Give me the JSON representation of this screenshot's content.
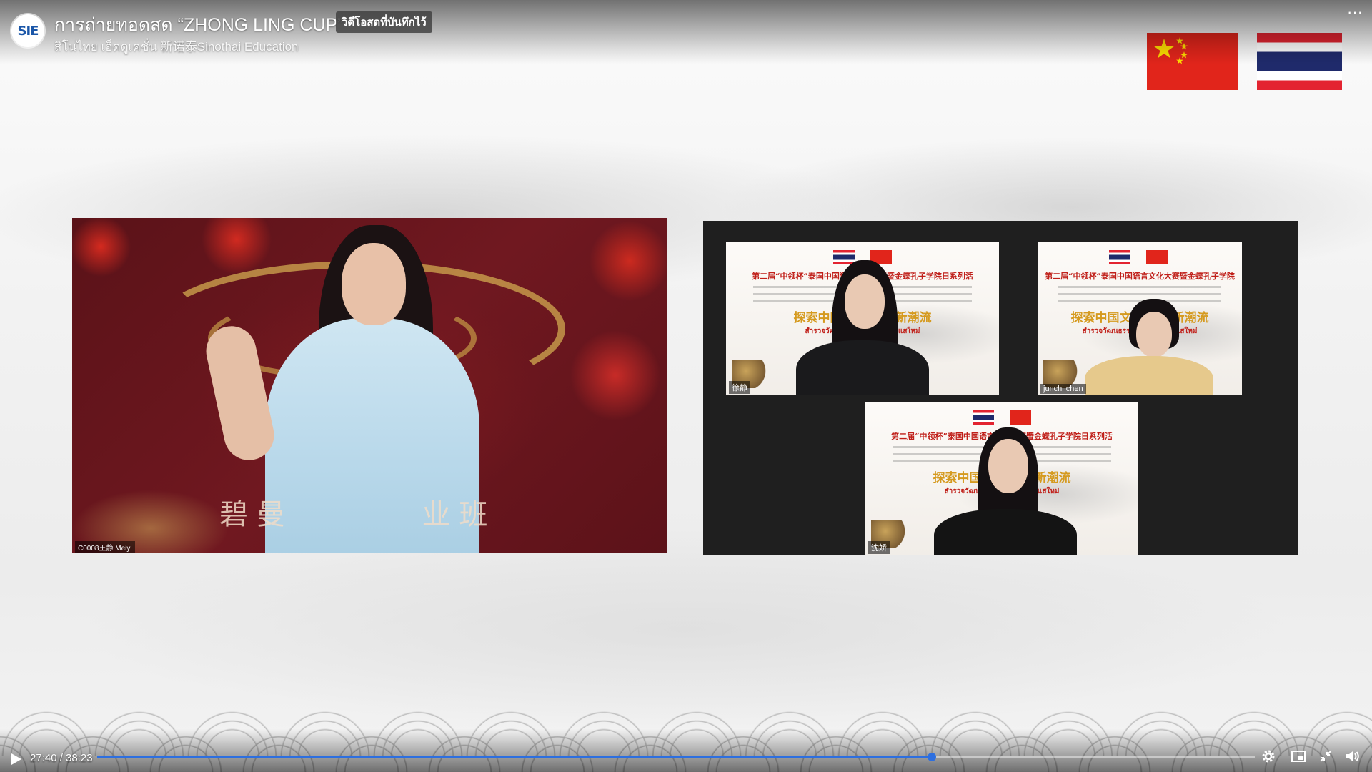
{
  "header": {
    "title": "การถ่ายทอดสด “ZHONG LING CUP”",
    "badge": "วิดีโอสดที่บันทึกไว้",
    "channel_name": "สิโนไทย เอ็ดดูเคชั่น 新诺泰Sinothai Education",
    "logo_text": "SIE",
    "more_label": "···"
  },
  "left_video": {
    "banner_text": "碧曼",
    "banner_text_2": "业班",
    "name_tag": "C0008王静 Meiyi"
  },
  "zoom_tiles": [
    {
      "line1": "第二届“中领杯”泰国中国语言文化大赛暨金蝶孔子学院日系列活",
      "gold": "探索中国文化 感受新潮流",
      "red": "สำรวจวัฒนธรรมจีน สัมผัสกระแสใหม่",
      "name_tag": "徐静"
    },
    {
      "line1": "第二届“中领杯”泰国中国语言文化大赛暨金蝶孔子学院",
      "gold": "探索中国文化 感受新潮流",
      "red": "สำรวจวัฒนธรรมจีน สัมผัสกระแสใหม่",
      "name_tag": "junchi chen"
    },
    {
      "line1": "第二届“中领杯”泰国中国语言文化大赛暨金蝶孔子学院日系列活",
      "gold": "探索中国文化 感受新潮流",
      "red": "สำรวจวัฒนธรรมจีน สัมผัสกระแสใหม่",
      "name_tag": "沈娇"
    }
  ],
  "player": {
    "time": "27:40 / 38:23",
    "progress_fraction": 0.7211,
    "accent_color": "#2d6fe0",
    "icons": {
      "play": "play-icon",
      "settings": "gear-icon",
      "pip": "picture-in-picture-icon",
      "fullscreen": "exit-fullscreen-icon",
      "volume": "volume-icon"
    }
  },
  "colors": {
    "china_red": "#e1251b",
    "thai_blue": "#1f2a6b",
    "thai_red": "#e32431"
  }
}
